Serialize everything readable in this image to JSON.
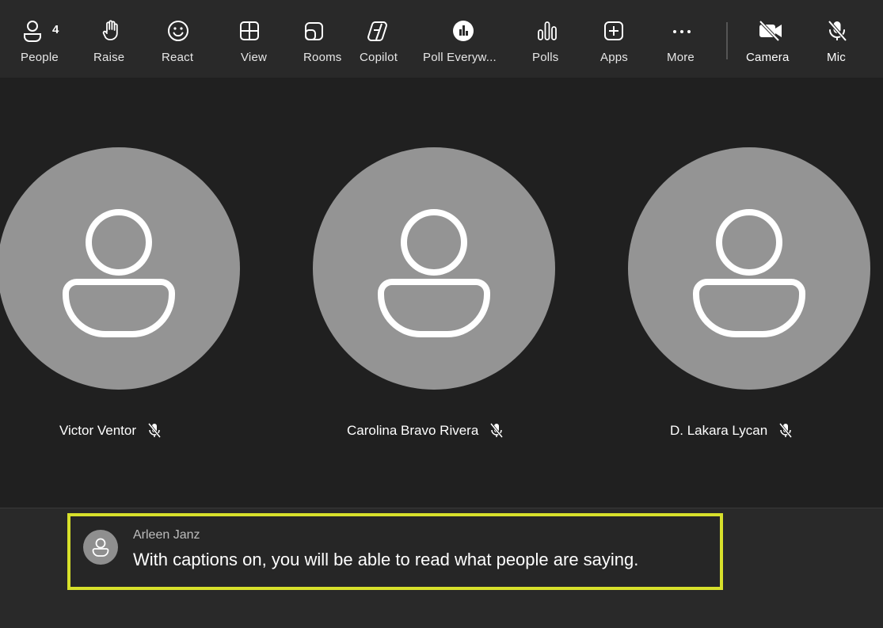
{
  "toolbar": {
    "people": {
      "label": "People",
      "count": "4",
      "icon": "people-icon"
    },
    "raise": {
      "label": "Raise",
      "icon": "raise-hand-icon"
    },
    "react": {
      "label": "React",
      "icon": "smiley-icon"
    },
    "view": {
      "label": "View",
      "icon": "grid-view-icon"
    },
    "rooms": {
      "label": "Rooms",
      "icon": "breakout-rooms-icon"
    },
    "copilot": {
      "label": "Copilot",
      "icon": "copilot-icon"
    },
    "poll_everywhere": {
      "label": "Poll Everyw...",
      "icon": "poll-everywhere-icon"
    },
    "polls": {
      "label": "Polls",
      "icon": "polls-icon"
    },
    "apps": {
      "label": "Apps",
      "icon": "apps-plus-icon"
    },
    "more": {
      "label": "More",
      "icon": "more-ellipsis-icon"
    },
    "camera": {
      "label": "Camera",
      "icon": "camera-off-icon"
    },
    "mic": {
      "label": "Mic",
      "icon": "mic-off-icon"
    }
  },
  "participants": [
    {
      "name": "Victor Ventor",
      "muted": true
    },
    {
      "name": "Carolina Bravo Rivera",
      "muted": true
    },
    {
      "name": "D. Lakara Lycan",
      "muted": true
    }
  ],
  "caption": {
    "speaker": "Arleen Janz",
    "text": "With captions on, you will be able to read what people are saying.",
    "highlight_color": "#d7e02b"
  },
  "colors": {
    "toolbar_bg": "#292929",
    "stage_bg": "#202020",
    "avatar_bg": "#949494"
  }
}
